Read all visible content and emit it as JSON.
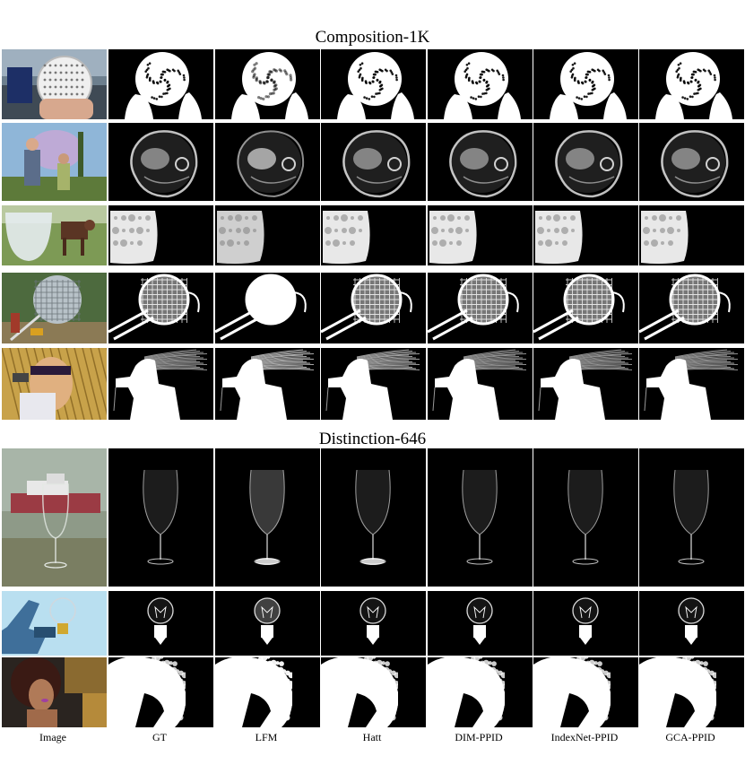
{
  "sections": [
    {
      "title": "Composition-1K"
    },
    {
      "title": "Distinction-646"
    }
  ],
  "columns": [
    "Image",
    "GT",
    "LFM",
    "Hatt",
    "DIM-PPID",
    "IndexNet-PPID",
    "GCA-PPID"
  ],
  "rows": [
    {
      "section": "Composition-1K",
      "subject": "mesh-sphere"
    },
    {
      "section": "Composition-1K",
      "subject": "jellyfish"
    },
    {
      "section": "Composition-1K",
      "subject": "glass-bowl"
    },
    {
      "section": "Composition-1K",
      "subject": "sieve"
    },
    {
      "section": "Composition-1K",
      "subject": "hair-dryer"
    },
    {
      "section": "Distinction-646",
      "subject": "wine-glass"
    },
    {
      "section": "Distinction-646",
      "subject": "light-bulb"
    },
    {
      "section": "Distinction-646",
      "subject": "curly-hair"
    }
  ]
}
